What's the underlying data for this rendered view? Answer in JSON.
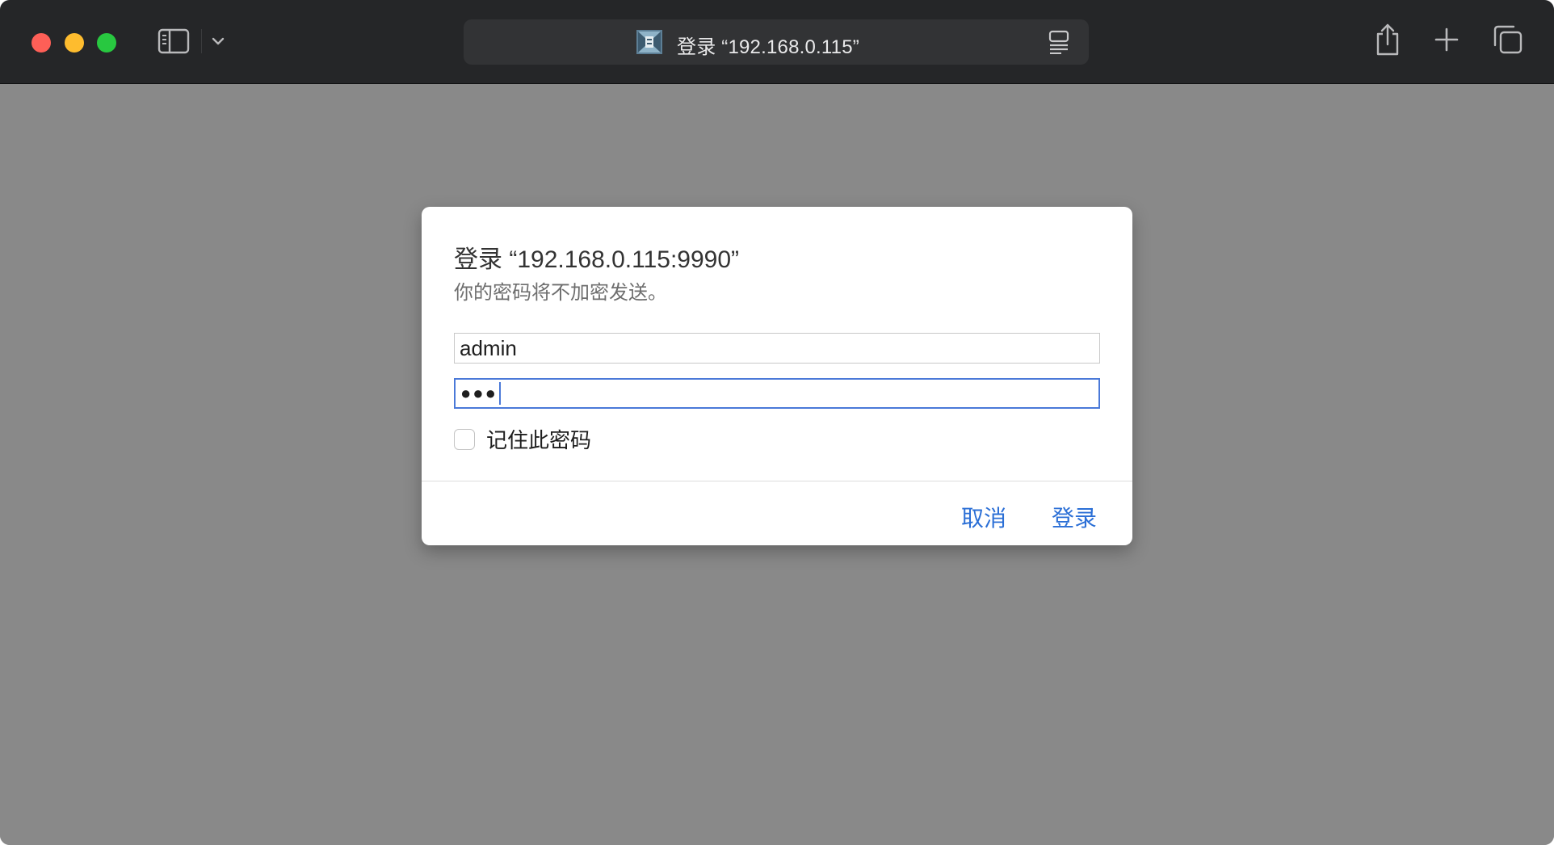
{
  "titlebar": {
    "address": "登录 “192.168.0.115”",
    "icons": {
      "sidebar": "sidebar-icon",
      "chevron": "chevron-down-icon",
      "favicon": "site-favicon-icon",
      "reader": "reader-icon",
      "share": "share-icon",
      "new_tab": "plus-icon",
      "tabs": "tab-overview-icon"
    }
  },
  "dialog": {
    "title": "登录 “192.168.0.115:9990”",
    "subtitle": "你的密码将不加密发送。",
    "username_value": "admin",
    "password_dots": "●●●",
    "remember_label": "记住此密码",
    "remember_checked": false,
    "cancel_label": "取消",
    "login_label": "登录"
  },
  "colors": {
    "titlebar_bg": "#252628",
    "page_bg": "#898989",
    "accent": "#2b6fd6",
    "focus_ring": "#4a79d8"
  }
}
